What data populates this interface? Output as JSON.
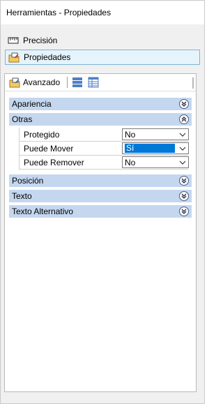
{
  "window": {
    "title": "Herramientas - Propiedades"
  },
  "nav": {
    "items": [
      {
        "label": "Precisión",
        "icon": "precision-ruler-icon",
        "selected": false
      },
      {
        "label": "Propiedades",
        "icon": "properties-folder-icon",
        "selected": true
      }
    ]
  },
  "toolbar": {
    "advanced_label": "Avanzado",
    "advanced_icon": "advanced-properties-icon",
    "buttons": [
      "categorized-view-icon",
      "list-view-icon"
    ]
  },
  "sections": [
    {
      "label": "Apariencia",
      "expanded": false
    },
    {
      "label": "Otras",
      "expanded": true
    },
    {
      "label": "Posición",
      "expanded": false
    },
    {
      "label": "Texto",
      "expanded": false
    },
    {
      "label": "Texto Alternativo",
      "expanded": false
    }
  ],
  "properties": [
    {
      "name": "Protegido",
      "value": "No",
      "highlighted": false
    },
    {
      "name": "Puede Mover",
      "value": "Sí",
      "highlighted": true
    },
    {
      "name": "Puede Remover",
      "value": "No",
      "highlighted": false
    }
  ],
  "colors": {
    "section_bg": "#c4d7ef",
    "selection_blue": "#0078d7",
    "nav_selected_bg": "#e5f3fb"
  }
}
